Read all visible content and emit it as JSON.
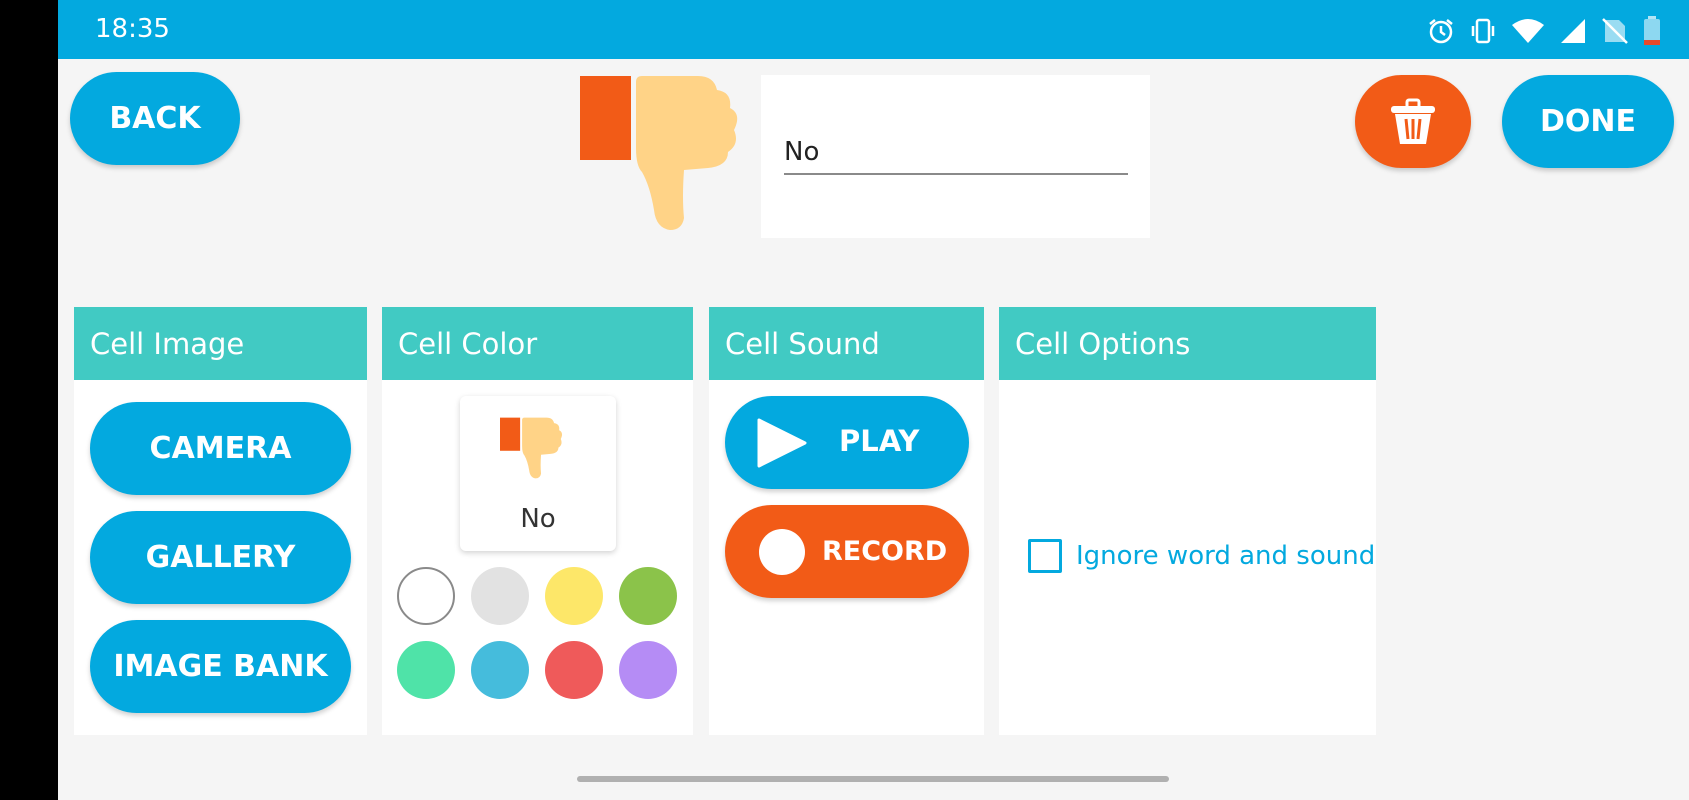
{
  "status_bar": {
    "time": "18:35"
  },
  "toolbar": {
    "back_label": "BACK",
    "done_label": "DONE"
  },
  "cell": {
    "word": "No",
    "preview_label": "No"
  },
  "panels": {
    "image": {
      "title": "Cell Image",
      "camera": "CAMERA",
      "gallery": "GALLERY",
      "image_bank": "IMAGE BANK"
    },
    "color": {
      "title": "Cell Color"
    },
    "sound": {
      "title": "Cell Sound",
      "play": "PLAY",
      "record": "RECORD"
    },
    "options": {
      "title": "Cell Options",
      "ignore_label": "Ignore word and sound"
    }
  },
  "swatches": [
    "#ffffff",
    "#e2e2e2",
    "#fde769",
    "#8bc34a",
    "#4fe3a8",
    "#45bcdc",
    "#ef5a5a",
    "#b58cf5"
  ],
  "colors": {
    "accent": "#03a9df",
    "orange": "#f25b17",
    "teal": "#41cac3"
  }
}
